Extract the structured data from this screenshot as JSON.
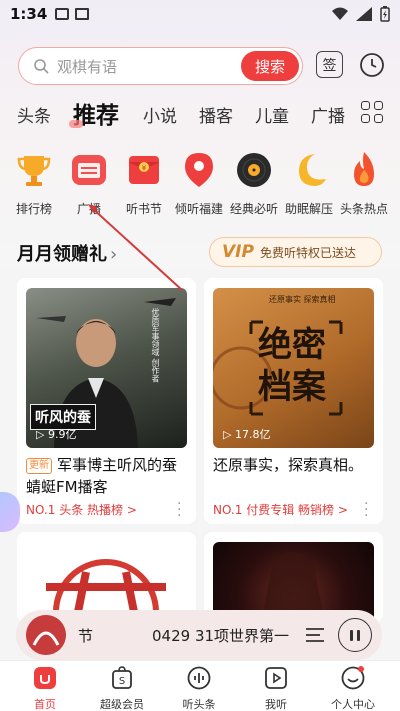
{
  "status": {
    "time": "1:34"
  },
  "search": {
    "placeholder": "观棋有语",
    "button": "搜索"
  },
  "header": {
    "sign": "签"
  },
  "tabs": [
    {
      "label": "头条"
    },
    {
      "label": "推荐",
      "active": true
    },
    {
      "label": "小说"
    },
    {
      "label": "播客"
    },
    {
      "label": "儿童"
    },
    {
      "label": "广播"
    }
  ],
  "categories": [
    {
      "label": "排行榜",
      "icon": "trophy-icon"
    },
    {
      "label": "广播",
      "icon": "radio-icon"
    },
    {
      "label": "听书节",
      "icon": "red-envelope-icon"
    },
    {
      "label": "倾听福建",
      "icon": "location-pin-icon"
    },
    {
      "label": "经典必听",
      "icon": "vinyl-record-icon"
    },
    {
      "label": "助眠解压",
      "icon": "moon-icon"
    },
    {
      "label": "头条热点",
      "icon": "flame-icon"
    }
  ],
  "section": {
    "title": "月月领赠礼",
    "chevron": "›",
    "vip_logo": "VIP",
    "vip_text": "免费听特权已送达"
  },
  "cards": [
    {
      "title_line1": "军事博主听风的蚕",
      "title_line2": "蜻蜓FM播客",
      "badge": "更新",
      "rank": "NO.1 头条 热播榜 >",
      "playcount": "▷ 9.9亿",
      "cover_text": "听风的蚕",
      "cover_tag": "优质军事领域 创作者"
    },
    {
      "title_line1": "还原事实，探索真相。",
      "rank": "NO.1 付费专辑 畅销榜 >",
      "playcount": "▷ 17.8亿",
      "cover_text1": "绝密",
      "cover_text2": "档案",
      "cover_tag": "还原事实 探索真相"
    }
  ],
  "player": {
    "title": "节",
    "title2": "0429 31项世界第一"
  },
  "nav": [
    {
      "label": "首页",
      "active": true
    },
    {
      "label": "超级会员"
    },
    {
      "label": "听头条"
    },
    {
      "label": "我听"
    },
    {
      "label": "个人中心"
    }
  ],
  "colors": {
    "accent": "#ee3e3e",
    "vip": "#d08a34"
  }
}
